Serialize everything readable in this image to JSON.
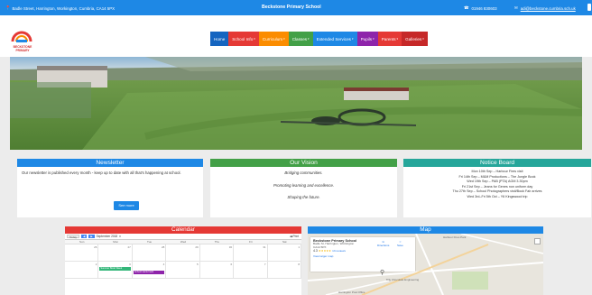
{
  "topbar": {
    "address": "Badle Street, Harrington, Workington, Cumbria, CA14 5PX",
    "school_name": "Beckstone Primary School",
    "phone": "01946 830603",
    "email": "adi@beckstone.cumbria.sch.uk"
  },
  "logo": {
    "text": "BECKSTONE PRIMARY"
  },
  "nav": [
    {
      "label": "Home",
      "color": "#1565c0",
      "dropdown": false
    },
    {
      "label": "School Info",
      "color": "#e53935",
      "dropdown": true
    },
    {
      "label": "Curriculum",
      "color": "#fb8c00",
      "dropdown": true
    },
    {
      "label": "Classes",
      "color": "#43a047",
      "dropdown": true
    },
    {
      "label": "Extended Services",
      "color": "#1e88e5",
      "dropdown": true
    },
    {
      "label": "Pupils",
      "color": "#8e24aa",
      "dropdown": true
    },
    {
      "label": "Parents",
      "color": "#e53935",
      "dropdown": true
    },
    {
      "label": "Galleries",
      "color": "#c62828",
      "dropdown": true
    }
  ],
  "newsletter": {
    "title": "Newsletter",
    "text": "Our newsletter is published every month - keep up to date with all that's happening at school.",
    "button": "See more"
  },
  "vision": {
    "title": "Our Vision",
    "lines": [
      "Bridging communities.",
      "Promoting learning and excellence.",
      "Shaping the future."
    ]
  },
  "notice": {
    "title": "Notice Board",
    "lines": [
      "Mon 10th Sep – Harbour Fires visit",
      "Fri 14th Sep – M&M Productions – The Jungle Book",
      "Wed 19th Sep – PAB (PTA) AGM 3.30pm",
      "Fri 21st Sep – Jeans for Genes non uniform day",
      "Thu 27th Sep – School Photographers visit/Book Fair arrives",
      "Wed 3rd–Fri 5th Oct – Y6 Kingswood trip"
    ]
  },
  "calendar": {
    "title": "Calendar",
    "today": "Today",
    "month": "September 2018",
    "print": "Print",
    "days": [
      "Sun",
      "Mon",
      "Tue",
      "Wed",
      "Thu",
      "Fri",
      "Sat"
    ],
    "dates": [
      "26",
      "27",
      "28",
      "29",
      "30",
      "31",
      "1",
      "2",
      "3",
      "4",
      "5",
      "6",
      "7",
      "8"
    ],
    "events": [
      {
        "label": "Summer Book Week",
        "cell": 8,
        "kind": "green"
      },
      {
        "label": "School starts back",
        "cell": 9,
        "kind": "purple"
      }
    ]
  },
  "map": {
    "title": "Map",
    "place": "Beckstone Primary School",
    "address": "Badle St, Harrington, Workington CA14 5PX",
    "rating": "4.3",
    "stars": "★★★★★",
    "reviews": "13 reviews",
    "directions": "Directions",
    "save": "Save",
    "larger": "View larger map",
    "labels": [
      "Harbour Fires Park",
      "Tilly Chocolate Engineering",
      "Harrington Post Office"
    ]
  }
}
